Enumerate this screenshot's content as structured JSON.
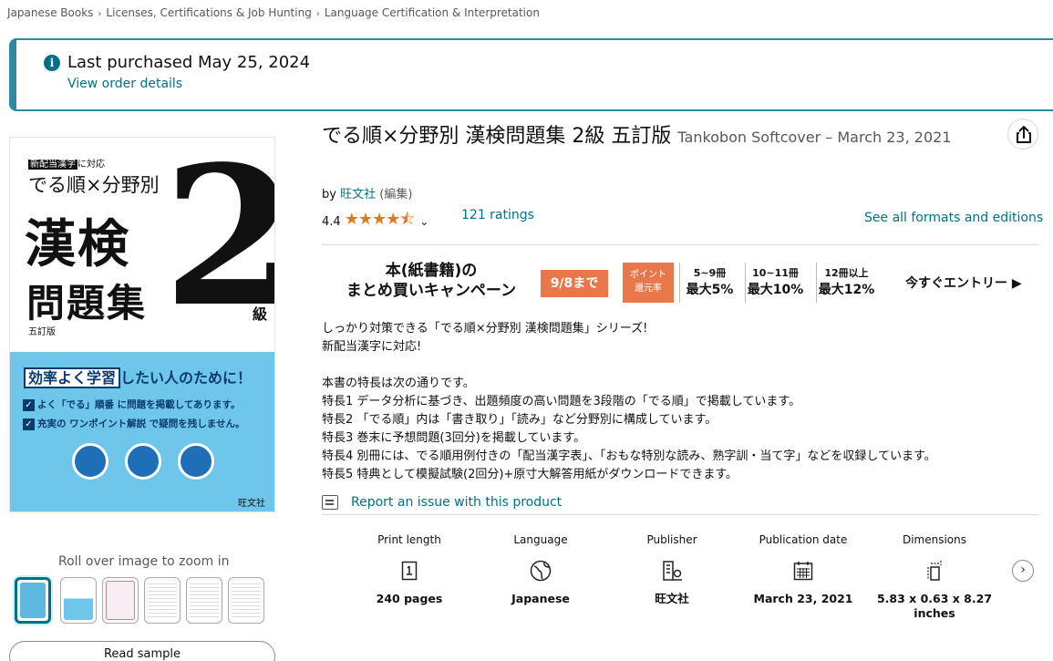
{
  "breadcrumb": [
    "Japanese Books",
    "Licenses, Certifications & Job Hunting",
    "Language Certification & Interpretation"
  ],
  "alert": {
    "title": "Last purchased May 25, 2024",
    "link": "View order details"
  },
  "cover": {
    "badge_highlight": "新配当漢字",
    "badge_rest": "に対応",
    "subtitle": "でる順×分野別",
    "title_line1": "漢検",
    "title_line2": "問題集",
    "edition": "五訂版",
    "level_number": "2",
    "level_suffix": "級",
    "banner_box": "効率よく学習",
    "banner_rest": "したい人のために！",
    "line1": "よく「でる」順番 に問題を掲載してあります。",
    "line2": "充実の ワンポイント解説 で疑問を残しません。",
    "publisher": "旺文社"
  },
  "zoom_hint": "Roll over image to zoom in",
  "read_sample": "Read sample",
  "product": {
    "title": "でる順×分野別 漢検問題集 2級 五訂版",
    "format": "Tankobon Softcover – March 23, 2021",
    "by": "by",
    "author": "旺文社",
    "role": "(編集)",
    "rating_value": "4.4",
    "stars": "★★★★⯪",
    "ratings_count": "121 ratings",
    "formats_link": "See all formats and editions"
  },
  "campaign": {
    "title_line1": "本(紙書籍)の",
    "title_line2": "まとめ買いキャンペーン",
    "until": "9/8まで",
    "point_line1": "ポイント",
    "point_line2": "還元率",
    "tiers": [
      {
        "count": "5~9冊",
        "rate": "最大5%"
      },
      {
        "count": "10~11冊",
        "rate": "最大10%"
      },
      {
        "count": "12冊以上",
        "rate": "最大12%"
      }
    ],
    "entry": "今すぐエントリー ▶"
  },
  "description": "しっかり対策できる「でる順×分野別 漢検問題集」シリーズ!\n新配当漢字に対応!\n\n本書の特長は次の通りです。\n特長1 データ分析に基づき、出題頻度の高い問題を3段階の「でる順」で掲載しています。\n特長2 「でる順」内は「書き取り」「読み」など分野別に構成しています。\n特長3 巻末に予想問題(3回分)を掲載しています。\n特長4 別冊には、でる順用例付きの「配当漢字表」、「おもな特別な読み、熟字訓・当て字」などを収録しています。\n特長5 特典として模擬試験(2回分)+原寸大解答用紙がダウンロードできます。",
  "report_link": "Report an issue with this product",
  "details": [
    {
      "label": "Print length",
      "icon": "pages-icon",
      "value": "240 pages"
    },
    {
      "label": "Language",
      "icon": "globe-icon",
      "value": "Japanese"
    },
    {
      "label": "Publisher",
      "icon": "building-icon",
      "value": "旺文社"
    },
    {
      "label": "Publication date",
      "icon": "calendar-icon",
      "value": "March 23, 2021"
    },
    {
      "label": "Dimensions",
      "icon": "dimensions-icon",
      "value": "5.83 x 0.63 x 8.27 inches"
    }
  ],
  "colors": {
    "link": "#007185",
    "star": "#de7921",
    "alert_accent": "#2e8aa0",
    "campaign_orange": "#e8774a",
    "cover_blue": "#6ec6ea"
  }
}
